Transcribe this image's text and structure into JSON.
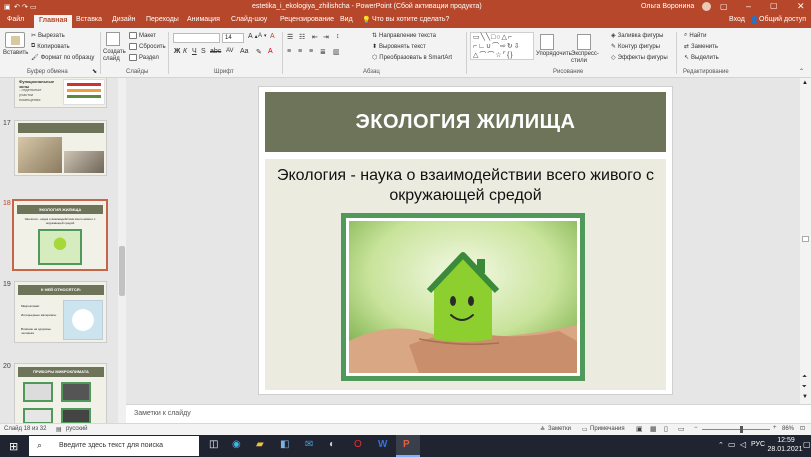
{
  "window": {
    "title": "estetika_i_ekologiya_zhilishcha - PowerPoint (Сбой активации продукта)",
    "user": "Ольга Воронина"
  },
  "ribbon_tabs": [
    "Файл",
    "Главная",
    "Вставка",
    "Дизайн",
    "Переходы",
    "Анимация",
    "Слайд-шоу",
    "Рецензирование",
    "Вид"
  ],
  "search_placeholder": "Что вы хотите сделать?",
  "tab_right": {
    "login": "Вход",
    "share": "Общий доступ"
  },
  "ribbon": {
    "paste": "Вставить",
    "cut": "Вырезать",
    "copy": "Копировать",
    "format_painter": "Формат по образцу",
    "clipboard_group": "Буфер обмена",
    "new_slide": "Создать слайд",
    "layout": "Макет",
    "reset": "Сбросить",
    "section": "Раздел",
    "slides_group": "Слайды",
    "font_size": "14",
    "font_group": "Шрифт",
    "text_direction": "Направление текста",
    "align_text": "Выровнять текст",
    "smartart": "Преобразовать в SmartArt",
    "paragraph_group": "Абзац",
    "arrange": "Упорядочить",
    "quick_styles": "Экспресс-стили",
    "shape_fill": "Заливка фигуры",
    "shape_outline": "Контур фигуры",
    "shape_effects": "Эффекты фигуры",
    "drawing_group": "Рисование",
    "find": "Найти",
    "replace": "Заменить",
    "select": "Выделить",
    "editing_group": "Редактирование"
  },
  "thumbnails": [
    {
      "number": "17",
      "title": ""
    },
    {
      "number": "18",
      "title": "ЭКОЛОГИЯ ЖИЛИЩА",
      "caption": "Экология - наука о взаимодействии всего живого с окружающей средой",
      "selected": true
    },
    {
      "number": "19",
      "title": "К НЕЙ ОТНОСЯТСЯ:",
      "items": [
        "Микроклимат",
        "Интерьерные материалы",
        "Влияние на здоровье человека"
      ]
    },
    {
      "number": "20",
      "title": "ПРИБОРЫ МИКРОКЛИМАТА"
    }
  ],
  "top_partial_thumb": {
    "title": "Функциональные зоны",
    "lines": [
      "- отдельные",
      "участки",
      "помещения"
    ]
  },
  "slide": {
    "title": "ЭКОЛОГИЯ ЖИЛИЩА",
    "text": "Экология - наука о взаимодействии всего живого с окружающей средой",
    "colors": {
      "title_bg": "#6e745a",
      "body_bg": "#ebebdf",
      "frame": "#4f9a5a"
    }
  },
  "notes_placeholder": "Заметки к слайду",
  "status": {
    "slide_info": "Слайд 18 из 32",
    "language": "русский",
    "notes": "Заметки",
    "comments": "Примечания",
    "zoom": "86%"
  },
  "taskbar": {
    "search_placeholder": "Введите здесь текст для поиска",
    "lang": "РУС",
    "time": "12:59",
    "date": "28.01.2021"
  }
}
